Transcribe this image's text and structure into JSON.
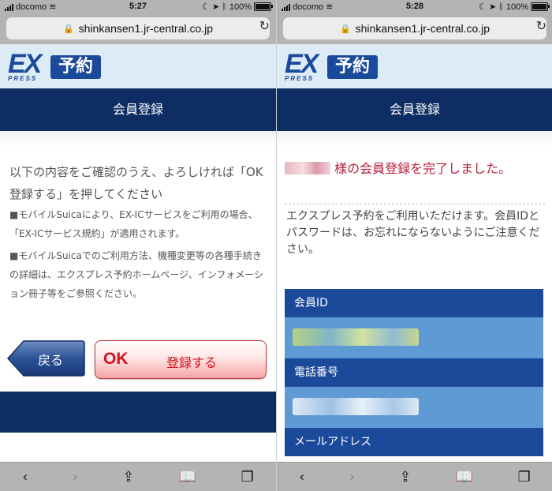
{
  "left": {
    "status": {
      "carrier": "docomo",
      "time": "5:27",
      "battery": "100%"
    },
    "url": "shinkansen1.jr-central.co.jp",
    "logo": {
      "ex": "EX",
      "press": "PRESS",
      "yoyaku": "予約"
    },
    "title": "会員登録",
    "message": "以下の内容をご確認のうえ、よろしければ「OK 登録する」を押してください",
    "notes": [
      "■モバイルSuicaにより、EX-ICサービスをご利用の場合、「EX-ICサービス規約」が適用されます。",
      "■モバイルSuicaでのご利用方法、機種変更等の各種手続きの詳細は、エクスプレス予約ホームページ、インフォメーション冊子等をご参照ください。"
    ],
    "back_label": "戻る",
    "ok": {
      "ok": "OK",
      "label": "登録する"
    }
  },
  "right": {
    "status": {
      "carrier": "docomo",
      "time": "5:28",
      "battery": "100%"
    },
    "url": "shinkansen1.jr-central.co.jp",
    "logo": {
      "ex": "EX",
      "press": "PRESS",
      "yoyaku": "予約"
    },
    "title": "会員登録",
    "complete_message": "様の会員登録を完了しました。",
    "info": "エクスプレス予約をご利用いただけます。会員IDとパスワードは、お忘れにならないようにご注意ください。",
    "fields": {
      "member_id": "会員ID",
      "phone": "電話番号",
      "email": "メールアドレス"
    }
  },
  "toolbar_icons": [
    "back-icon",
    "forward-icon",
    "share-icon",
    "bookmarks-icon",
    "tabs-icon"
  ]
}
